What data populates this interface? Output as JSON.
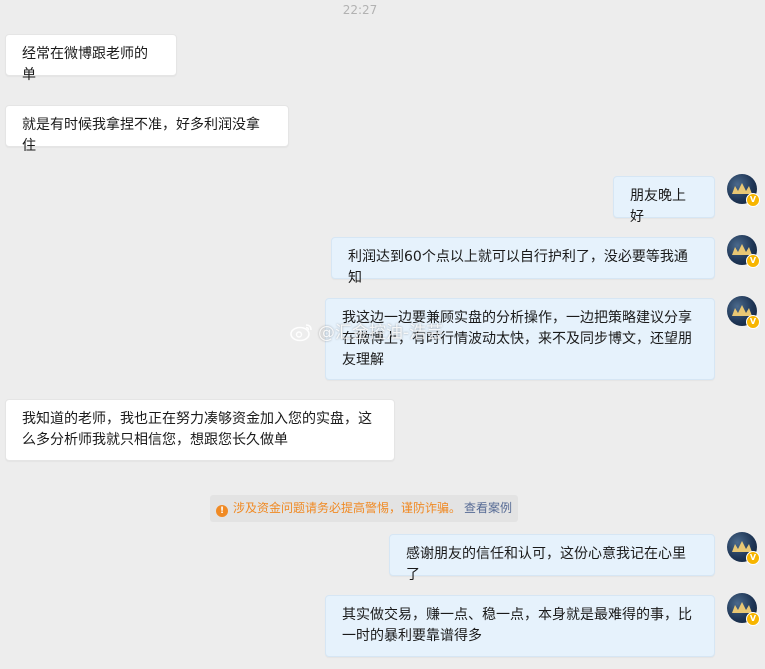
{
  "chat": {
    "timestamp": "22:27",
    "messages": [
      {
        "side": "left",
        "text": "经常在微博跟老师的单"
      },
      {
        "side": "left",
        "text": "就是有时候我拿捏不准，好多利润没拿住"
      },
      {
        "side": "right",
        "text": "朋友晚上好"
      },
      {
        "side": "right",
        "text": "利润达到60个点以上就可以自行护利了，没必要等我通知"
      },
      {
        "side": "right",
        "text": "我这边一边要兼顾实盘的分析操作，一边把策略建议分享在微博上，有时行情波动太快，来不及同步博文，还望朋友理解"
      },
      {
        "side": "left",
        "text": "我知道的老师，我也正在努力凑够资金加入您的实盘，这么多分析师我就只相信您，想跟您长久做单"
      },
      {
        "side": "right",
        "text": "感谢朋友的信任和认可，这份心意我记在心里了"
      },
      {
        "side": "right",
        "text": "其实做交易，赚一点、稳一点，本身就是最难得的事，比一时的暴利要靠谱得多"
      }
    ],
    "notice": {
      "text": "涉及资金问题请务必提高警惕，谨防诈骗。",
      "link": "查看案例",
      "color": "#f08a24"
    },
    "watermark": "@汇金控油-浩芸"
  },
  "avatar": {
    "badge": "V",
    "icon": "user-avatar-icon"
  },
  "colors": {
    "background": "#ededed",
    "bubble_left": "#ffffff",
    "bubble_right": "#e6f2fc",
    "badge": "#f7b500",
    "link": "#576b95"
  }
}
